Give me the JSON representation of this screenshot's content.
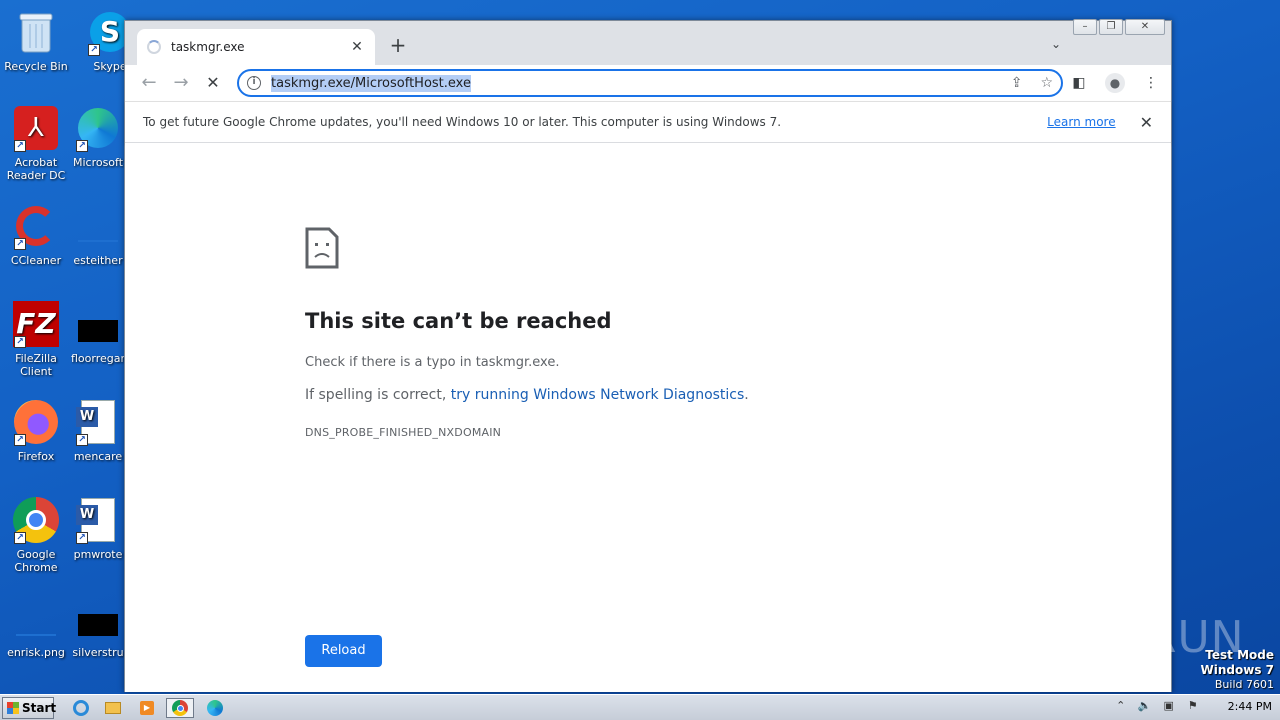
{
  "desktop": {
    "icons": [
      {
        "label": "Recycle Bin"
      },
      {
        "label": "Skype"
      },
      {
        "label": "Acrobat Reader DC"
      },
      {
        "label": "Microsoft"
      },
      {
        "label": "CCleaner"
      },
      {
        "label": "esteither"
      },
      {
        "label": "FileZilla Client"
      },
      {
        "label": "floorregar"
      },
      {
        "label": "Firefox"
      },
      {
        "label": "mencare"
      },
      {
        "label": "Google Chrome"
      },
      {
        "label": "pmwrote"
      },
      {
        "label": "enrisk.png"
      },
      {
        "label": "silverstru"
      }
    ]
  },
  "browser": {
    "tab_title": "taskmgr.exe",
    "new_tab_label": "+",
    "url": "taskmgr.exe/MicrosoftHost.exe",
    "infobar": {
      "message": "To get future Google Chrome updates, you'll need Windows 10 or later. This computer is using Windows 7.",
      "learn_more": "Learn more"
    },
    "error": {
      "title": "This site can’t be reached",
      "line1": "Check if there is a typo in taskmgr.exe.",
      "line2_prefix": "If spelling is correct, ",
      "line2_link": "try running Windows Network Diagnostics",
      "line2_suffix": ".",
      "code": "DNS_PROBE_FINISHED_NXDOMAIN",
      "reload_label": "Reload"
    }
  },
  "watermark": "ANY RUN",
  "test_mode": {
    "line1": "Test Mode",
    "line2": "Windows 7",
    "line3": "Build 7601"
  },
  "taskbar": {
    "start_label": "Start",
    "clock": "2:44 PM"
  },
  "colors": {
    "accent": "#1a73e8",
    "desktop": "#1360c4",
    "link": "#1a5fb4"
  }
}
